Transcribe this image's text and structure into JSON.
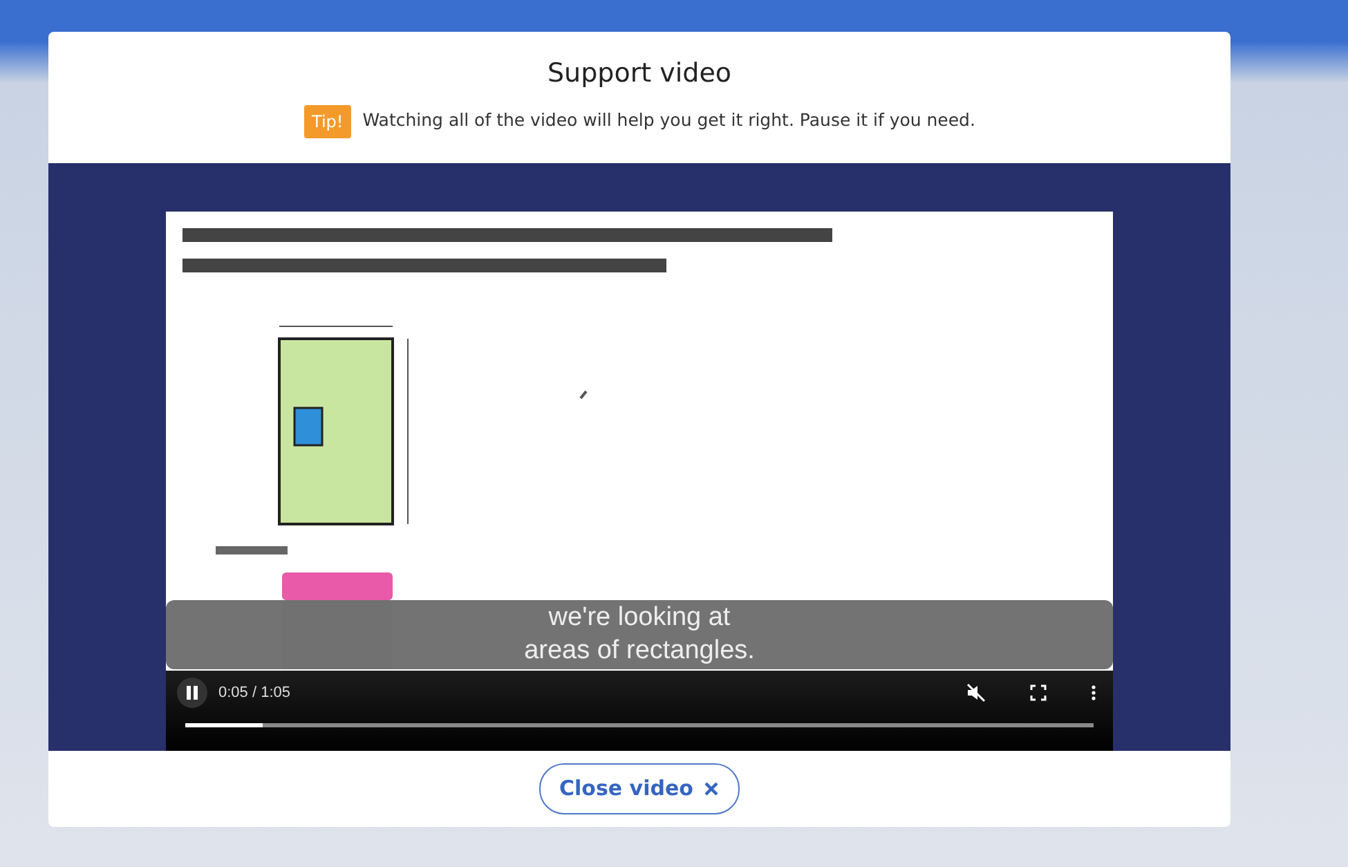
{
  "dialog": {
    "title": "Support video",
    "tip": {
      "badge": "Tip!",
      "text": "Watching all of the video will help you get it right. Pause it if you need."
    },
    "video": {
      "captions": [
        "we're looking at",
        "areas of rectangles."
      ],
      "time": "0:05 / 1:05",
      "progress": {
        "level": 0.085
      }
    },
    "close_button": {
      "label": "Close video"
    }
  }
}
